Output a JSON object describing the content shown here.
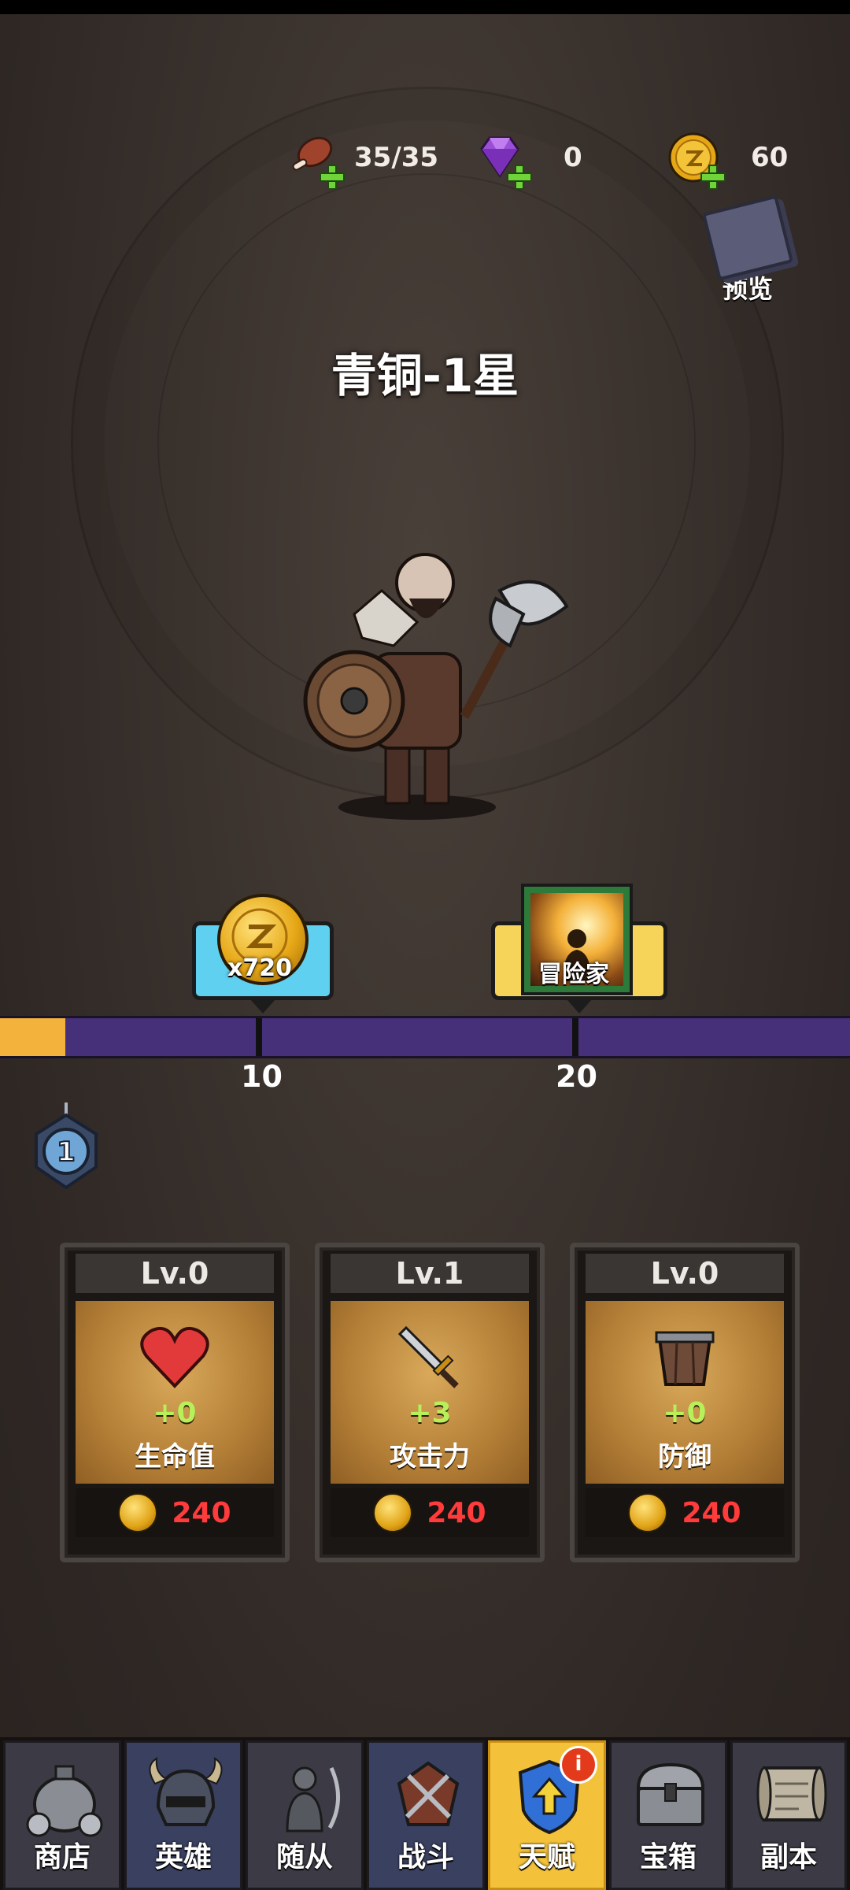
{
  "resources": {
    "stamina": {
      "value": "35/35",
      "icon": "meat-icon"
    },
    "gems": {
      "value": "0",
      "icon": "gem-icon"
    },
    "coins": {
      "value": "60",
      "icon": "coin-icon"
    }
  },
  "preview_label": "预览",
  "rank_title": "青铜-1星",
  "rewards": [
    {
      "label": "x720",
      "icon": "coin-icon"
    },
    {
      "label": "冒险家",
      "icon": "adventurer-icon"
    }
  ],
  "progress": {
    "fraction": 0.077,
    "ticks": [
      "10",
      "20"
    ],
    "current_level": "1"
  },
  "colors": {
    "accent": "#f4c23a",
    "cost": "#ff3b3b",
    "bonus": "#b8f05a",
    "bar": "#47307a"
  },
  "cards": [
    {
      "level": "Lv.0",
      "bonus": "+0",
      "name": "生命值",
      "cost": "240",
      "icon": "heart-icon"
    },
    {
      "level": "Lv.1",
      "bonus": "+3",
      "name": "攻击力",
      "cost": "240",
      "icon": "sword-icon"
    },
    {
      "level": "Lv.0",
      "bonus": "+0",
      "name": "防御",
      "cost": "240",
      "icon": "bucket-icon"
    }
  ],
  "nav": {
    "tabs": [
      {
        "label": "商店",
        "icon": "shop-icon"
      },
      {
        "label": "英雄",
        "icon": "helmet-icon"
      },
      {
        "label": "随从",
        "icon": "follower-icon"
      },
      {
        "label": "战斗",
        "icon": "battle-icon"
      },
      {
        "label": "天赋",
        "icon": "talent-icon",
        "active": true,
        "badge": "i"
      },
      {
        "label": "宝箱",
        "icon": "chest-icon"
      },
      {
        "label": "副本",
        "icon": "scroll-icon"
      }
    ]
  }
}
